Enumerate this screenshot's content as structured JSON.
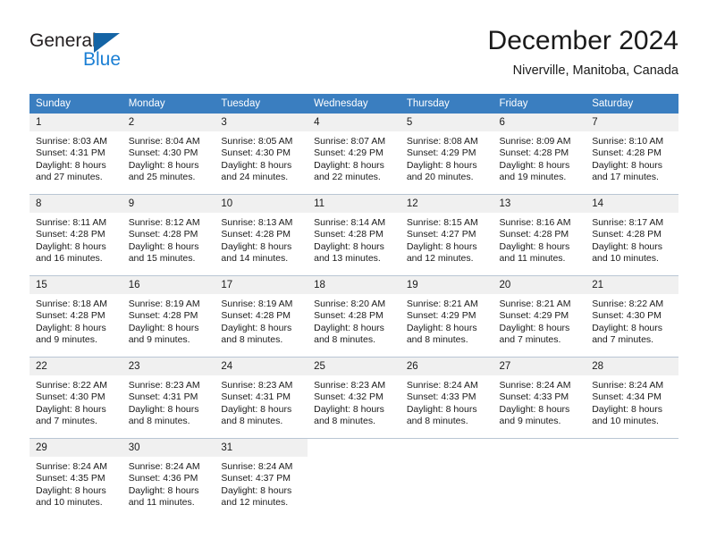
{
  "brand": {
    "name_part1": "General",
    "name_part2": "Blue",
    "triangle_color": "#1464a5",
    "blue_color": "#1b7fd4"
  },
  "header": {
    "title": "December 2024",
    "subtitle": "Niverville, Manitoba, Canada"
  },
  "theme": {
    "header_bg": "#3a7ec0",
    "header_text": "#ffffff",
    "daynum_bg": "#f0f0f0",
    "row_border": "#b9c6d4",
    "text": "#1a1a1a"
  },
  "weekdays": [
    "Sunday",
    "Monday",
    "Tuesday",
    "Wednesday",
    "Thursday",
    "Friday",
    "Saturday"
  ],
  "weeks": [
    [
      {
        "day": "1",
        "sunrise": "Sunrise: 8:03 AM",
        "sunset": "Sunset: 4:31 PM",
        "daylight1": "Daylight: 8 hours",
        "daylight2": "and 27 minutes."
      },
      {
        "day": "2",
        "sunrise": "Sunrise: 8:04 AM",
        "sunset": "Sunset: 4:30 PM",
        "daylight1": "Daylight: 8 hours",
        "daylight2": "and 25 minutes."
      },
      {
        "day": "3",
        "sunrise": "Sunrise: 8:05 AM",
        "sunset": "Sunset: 4:30 PM",
        "daylight1": "Daylight: 8 hours",
        "daylight2": "and 24 minutes."
      },
      {
        "day": "4",
        "sunrise": "Sunrise: 8:07 AM",
        "sunset": "Sunset: 4:29 PM",
        "daylight1": "Daylight: 8 hours",
        "daylight2": "and 22 minutes."
      },
      {
        "day": "5",
        "sunrise": "Sunrise: 8:08 AM",
        "sunset": "Sunset: 4:29 PM",
        "daylight1": "Daylight: 8 hours",
        "daylight2": "and 20 minutes."
      },
      {
        "day": "6",
        "sunrise": "Sunrise: 8:09 AM",
        "sunset": "Sunset: 4:28 PM",
        "daylight1": "Daylight: 8 hours",
        "daylight2": "and 19 minutes."
      },
      {
        "day": "7",
        "sunrise": "Sunrise: 8:10 AM",
        "sunset": "Sunset: 4:28 PM",
        "daylight1": "Daylight: 8 hours",
        "daylight2": "and 17 minutes."
      }
    ],
    [
      {
        "day": "8",
        "sunrise": "Sunrise: 8:11 AM",
        "sunset": "Sunset: 4:28 PM",
        "daylight1": "Daylight: 8 hours",
        "daylight2": "and 16 minutes."
      },
      {
        "day": "9",
        "sunrise": "Sunrise: 8:12 AM",
        "sunset": "Sunset: 4:28 PM",
        "daylight1": "Daylight: 8 hours",
        "daylight2": "and 15 minutes."
      },
      {
        "day": "10",
        "sunrise": "Sunrise: 8:13 AM",
        "sunset": "Sunset: 4:28 PM",
        "daylight1": "Daylight: 8 hours",
        "daylight2": "and 14 minutes."
      },
      {
        "day": "11",
        "sunrise": "Sunrise: 8:14 AM",
        "sunset": "Sunset: 4:28 PM",
        "daylight1": "Daylight: 8 hours",
        "daylight2": "and 13 minutes."
      },
      {
        "day": "12",
        "sunrise": "Sunrise: 8:15 AM",
        "sunset": "Sunset: 4:27 PM",
        "daylight1": "Daylight: 8 hours",
        "daylight2": "and 12 minutes."
      },
      {
        "day": "13",
        "sunrise": "Sunrise: 8:16 AM",
        "sunset": "Sunset: 4:28 PM",
        "daylight1": "Daylight: 8 hours",
        "daylight2": "and 11 minutes."
      },
      {
        "day": "14",
        "sunrise": "Sunrise: 8:17 AM",
        "sunset": "Sunset: 4:28 PM",
        "daylight1": "Daylight: 8 hours",
        "daylight2": "and 10 minutes."
      }
    ],
    [
      {
        "day": "15",
        "sunrise": "Sunrise: 8:18 AM",
        "sunset": "Sunset: 4:28 PM",
        "daylight1": "Daylight: 8 hours",
        "daylight2": "and 9 minutes."
      },
      {
        "day": "16",
        "sunrise": "Sunrise: 8:19 AM",
        "sunset": "Sunset: 4:28 PM",
        "daylight1": "Daylight: 8 hours",
        "daylight2": "and 9 minutes."
      },
      {
        "day": "17",
        "sunrise": "Sunrise: 8:19 AM",
        "sunset": "Sunset: 4:28 PM",
        "daylight1": "Daylight: 8 hours",
        "daylight2": "and 8 minutes."
      },
      {
        "day": "18",
        "sunrise": "Sunrise: 8:20 AM",
        "sunset": "Sunset: 4:28 PM",
        "daylight1": "Daylight: 8 hours",
        "daylight2": "and 8 minutes."
      },
      {
        "day": "19",
        "sunrise": "Sunrise: 8:21 AM",
        "sunset": "Sunset: 4:29 PM",
        "daylight1": "Daylight: 8 hours",
        "daylight2": "and 8 minutes."
      },
      {
        "day": "20",
        "sunrise": "Sunrise: 8:21 AM",
        "sunset": "Sunset: 4:29 PM",
        "daylight1": "Daylight: 8 hours",
        "daylight2": "and 7 minutes."
      },
      {
        "day": "21",
        "sunrise": "Sunrise: 8:22 AM",
        "sunset": "Sunset: 4:30 PM",
        "daylight1": "Daylight: 8 hours",
        "daylight2": "and 7 minutes."
      }
    ],
    [
      {
        "day": "22",
        "sunrise": "Sunrise: 8:22 AM",
        "sunset": "Sunset: 4:30 PM",
        "daylight1": "Daylight: 8 hours",
        "daylight2": "and 7 minutes."
      },
      {
        "day": "23",
        "sunrise": "Sunrise: 8:23 AM",
        "sunset": "Sunset: 4:31 PM",
        "daylight1": "Daylight: 8 hours",
        "daylight2": "and 8 minutes."
      },
      {
        "day": "24",
        "sunrise": "Sunrise: 8:23 AM",
        "sunset": "Sunset: 4:31 PM",
        "daylight1": "Daylight: 8 hours",
        "daylight2": "and 8 minutes."
      },
      {
        "day": "25",
        "sunrise": "Sunrise: 8:23 AM",
        "sunset": "Sunset: 4:32 PM",
        "daylight1": "Daylight: 8 hours",
        "daylight2": "and 8 minutes."
      },
      {
        "day": "26",
        "sunrise": "Sunrise: 8:24 AM",
        "sunset": "Sunset: 4:33 PM",
        "daylight1": "Daylight: 8 hours",
        "daylight2": "and 8 minutes."
      },
      {
        "day": "27",
        "sunrise": "Sunrise: 8:24 AM",
        "sunset": "Sunset: 4:33 PM",
        "daylight1": "Daylight: 8 hours",
        "daylight2": "and 9 minutes."
      },
      {
        "day": "28",
        "sunrise": "Sunrise: 8:24 AM",
        "sunset": "Sunset: 4:34 PM",
        "daylight1": "Daylight: 8 hours",
        "daylight2": "and 10 minutes."
      }
    ],
    [
      {
        "day": "29",
        "sunrise": "Sunrise: 8:24 AM",
        "sunset": "Sunset: 4:35 PM",
        "daylight1": "Daylight: 8 hours",
        "daylight2": "and 10 minutes."
      },
      {
        "day": "30",
        "sunrise": "Sunrise: 8:24 AM",
        "sunset": "Sunset: 4:36 PM",
        "daylight1": "Daylight: 8 hours",
        "daylight2": "and 11 minutes."
      },
      {
        "day": "31",
        "sunrise": "Sunrise: 8:24 AM",
        "sunset": "Sunset: 4:37 PM",
        "daylight1": "Daylight: 8 hours",
        "daylight2": "and 12 minutes."
      },
      {
        "day": "",
        "sunrise": "",
        "sunset": "",
        "daylight1": "",
        "daylight2": ""
      },
      {
        "day": "",
        "sunrise": "",
        "sunset": "",
        "daylight1": "",
        "daylight2": ""
      },
      {
        "day": "",
        "sunrise": "",
        "sunset": "",
        "daylight1": "",
        "daylight2": ""
      },
      {
        "day": "",
        "sunrise": "",
        "sunset": "",
        "daylight1": "",
        "daylight2": ""
      }
    ]
  ]
}
